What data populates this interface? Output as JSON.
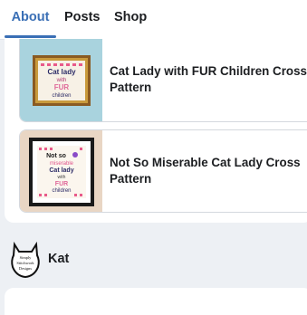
{
  "tabs": [
    {
      "label": "About",
      "active": true
    },
    {
      "label": "Posts",
      "active": false
    },
    {
      "label": "Shop",
      "active": false
    }
  ],
  "accent_color": "#3a6fb5",
  "products": [
    {
      "title_line1": "Cat Lady with FUR Children Cross",
      "title_line2": "Pattern",
      "thumb_text": [
        "Cat lady",
        "with",
        "FUR",
        "children"
      ]
    },
    {
      "title_line1": "Not So Miserable Cat Lady Cross",
      "title_line2": "Pattern",
      "thumb_text": [
        "Not so",
        "miserable",
        "Cat lady",
        "with",
        "FUR",
        "children"
      ]
    }
  ],
  "seller": {
    "name": "Kat",
    "avatar_text": [
      "Simply",
      "Stitchwork",
      "Designs"
    ]
  }
}
